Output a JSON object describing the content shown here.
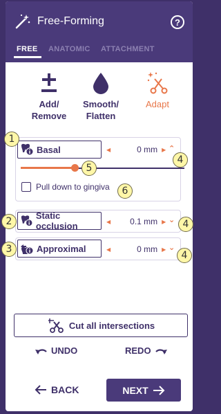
{
  "header": {
    "title": "Free-Forming",
    "help_label": "?",
    "tabs": [
      {
        "label": "FREE",
        "active": true
      },
      {
        "label": "ANATOMIC",
        "active": false
      },
      {
        "label": "ATTACHMENT",
        "active": false
      }
    ]
  },
  "tools": [
    {
      "label_line1": "Add/",
      "label_line2": "Remove",
      "icon": "plus-minus-icon"
    },
    {
      "label_line1": "Smooth/",
      "label_line2": "Flatten",
      "icon": "drop-icon"
    },
    {
      "label_line1": "Adapt",
      "label_line2": "",
      "icon": "sparkle-scissors-icon",
      "active": true
    }
  ],
  "groups": {
    "basal": {
      "label": "Basal",
      "value": "0 mm",
      "slider_fraction": 0.33,
      "checkbox_label": "Pull down to gingiva",
      "checked": false
    },
    "static_occlusion": {
      "label": "Static occlusion",
      "value": "0.1 mm"
    },
    "approximal": {
      "label": "Approximal",
      "value": "0 mm"
    }
  },
  "markers": [
    "1",
    "2",
    "3",
    "4",
    "4",
    "4",
    "5",
    "6"
  ],
  "actions": {
    "cut_label": "Cut all intersections",
    "undo_label": "UNDO",
    "redo_label": "REDO",
    "back_label": "BACK",
    "next_label": "NEXT"
  },
  "colors": {
    "primary": "#4a3a7a",
    "accent": "#e8774a",
    "marker": "#fff7a8"
  }
}
